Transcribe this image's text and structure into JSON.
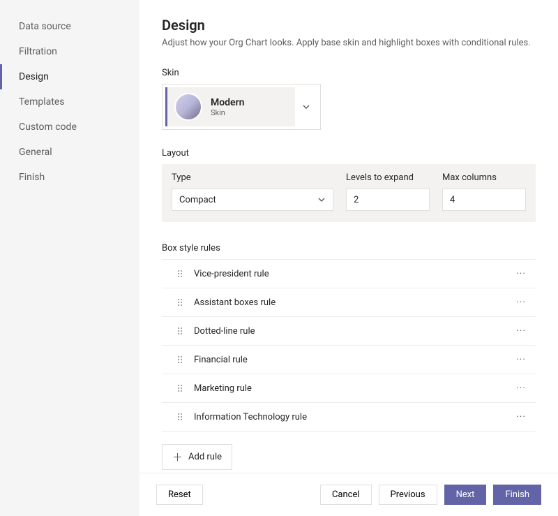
{
  "sidebar": {
    "items": [
      {
        "label": "Data source"
      },
      {
        "label": "Filtration"
      },
      {
        "label": "Design",
        "active": true
      },
      {
        "label": "Templates"
      },
      {
        "label": "Custom code"
      },
      {
        "label": "General"
      },
      {
        "label": "Finish"
      }
    ]
  },
  "page": {
    "title": "Design",
    "subtitle": "Adjust how your Org Chart looks. Apply base skin and highlight boxes with conditional rules."
  },
  "skin": {
    "section_label": "Skin",
    "name": "Modern",
    "sub": "Skin"
  },
  "layout": {
    "section_label": "Layout",
    "type_label": "Type",
    "type_value": "Compact",
    "levels_label": "Levels to expand",
    "levels_value": "2",
    "maxcols_label": "Max columns",
    "maxcols_value": "4"
  },
  "rules": {
    "section_label": "Box style rules",
    "items": [
      {
        "name": "Vice-president rule"
      },
      {
        "name": "Assistant boxes rule"
      },
      {
        "name": "Dotted-line rule"
      },
      {
        "name": "Financial rule"
      },
      {
        "name": "Marketing rule"
      },
      {
        "name": "Information Technology rule"
      }
    ],
    "add_label": "Add rule"
  },
  "footer": {
    "reset": "Reset",
    "cancel": "Cancel",
    "previous": "Previous",
    "next": "Next",
    "finish": "Finish"
  }
}
